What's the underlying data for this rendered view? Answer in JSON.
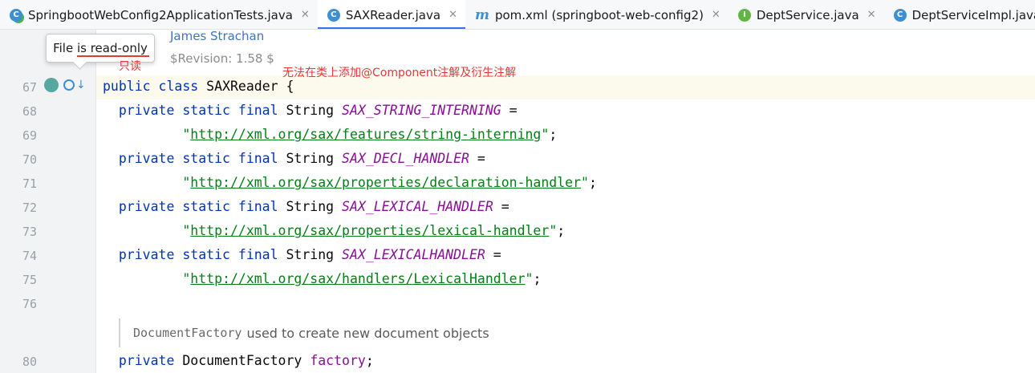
{
  "tabs": [
    {
      "label": "SpringbootWebConfig2ApplicationTests.java",
      "icon": "test-class-icon",
      "active": false
    },
    {
      "label": "SAXReader.java",
      "icon": "class-icon",
      "active": true
    },
    {
      "label": "pom.xml (springboot-web-config2)",
      "icon": "maven-icon",
      "active": false
    },
    {
      "label": "DeptService.java",
      "icon": "interface-icon",
      "active": false
    },
    {
      "label": "DeptServiceImpl.java",
      "icon": "class-icon",
      "active": false
    }
  ],
  "tab_close_glyph": "✕",
  "tooltip": {
    "text": "File is read-only"
  },
  "annotations": {
    "readonly_cn": "只读",
    "cannot_annotate_cn": "无法在类上添加@Component注解及衍生注解"
  },
  "doc_meta": {
    "author_value": "James Strachan",
    "version_value": "$Revision: 1.58 $"
  },
  "line_numbers": [
    "67",
    "68",
    "69",
    "70",
    "71",
    "72",
    "73",
    "74",
    "75",
    "76",
    "80"
  ],
  "code": {
    "l67": {
      "kw": "public class",
      "name": " SAXReader {"
    },
    "kw_field": "private static final",
    "type_string": " String ",
    "l68": {
      "const": "SAX_STRING_INTERNING",
      "eq": " ="
    },
    "l69": {
      "q1": "\"",
      "url": "http://xml.org/sax/features/string-interning",
      "q2": "\"",
      "end": ";"
    },
    "l70": {
      "const": "SAX_DECL_HANDLER",
      "eq": " ="
    },
    "l71": {
      "q1": "\"",
      "url": "http://xml.org/sax/properties/declaration-handler",
      "q2": "\"",
      "end": ";"
    },
    "l72": {
      "const": "SAX_LEXICAL_HANDLER",
      "eq": " ="
    },
    "l73": {
      "q1": "\"",
      "url": "http://xml.org/sax/properties/lexical-handler",
      "q2": "\"",
      "end": ";"
    },
    "l74": {
      "const": "SAX_LEXICALHANDLER",
      "eq": " ="
    },
    "l75": {
      "q1": "\"",
      "url": "http://xml.org/sax/handlers/LexicalHandler",
      "q2": "\"",
      "end": ";"
    },
    "doc": {
      "mono": "DocumentFactory",
      "text": "used to create new document objects"
    },
    "l80": {
      "kw": "private",
      "type": " DocumentFactory ",
      "field": "factory",
      "end": ";"
    }
  }
}
